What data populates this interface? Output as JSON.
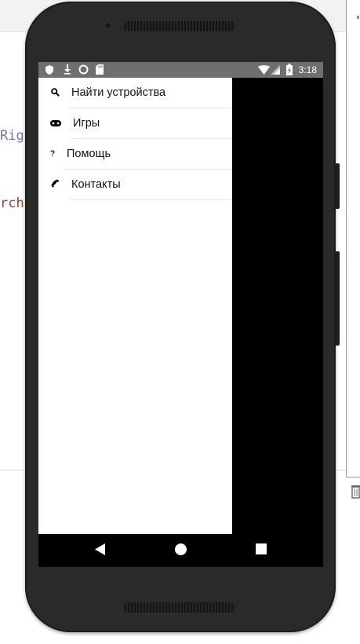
{
  "ide": {
    "code_fragment_1": "Rig",
    "code_fragment_2": "rch"
  },
  "statusbar": {
    "time": "3:18",
    "icons": [
      "shield-icon",
      "download-icon",
      "circle-icon",
      "sd-card-icon",
      "wifi-icon",
      "signal-icon",
      "battery-charging-icon"
    ]
  },
  "drawer": {
    "items": [
      {
        "label": "Найти устройства",
        "icon": "search-icon"
      },
      {
        "label": "Игры",
        "icon": "gamepad-icon"
      },
      {
        "label": "Помощь",
        "icon": "help-icon"
      },
      {
        "label": "Контакты",
        "icon": "phone-icon"
      }
    ]
  },
  "navbar": {
    "buttons": [
      "back-icon",
      "home-icon",
      "recents-icon"
    ]
  },
  "colors": {
    "phone_body": "#2a2a2a",
    "statusbar": "#6f6f6f",
    "drawer_bg": "#ffffff",
    "scrim": "#000000"
  }
}
